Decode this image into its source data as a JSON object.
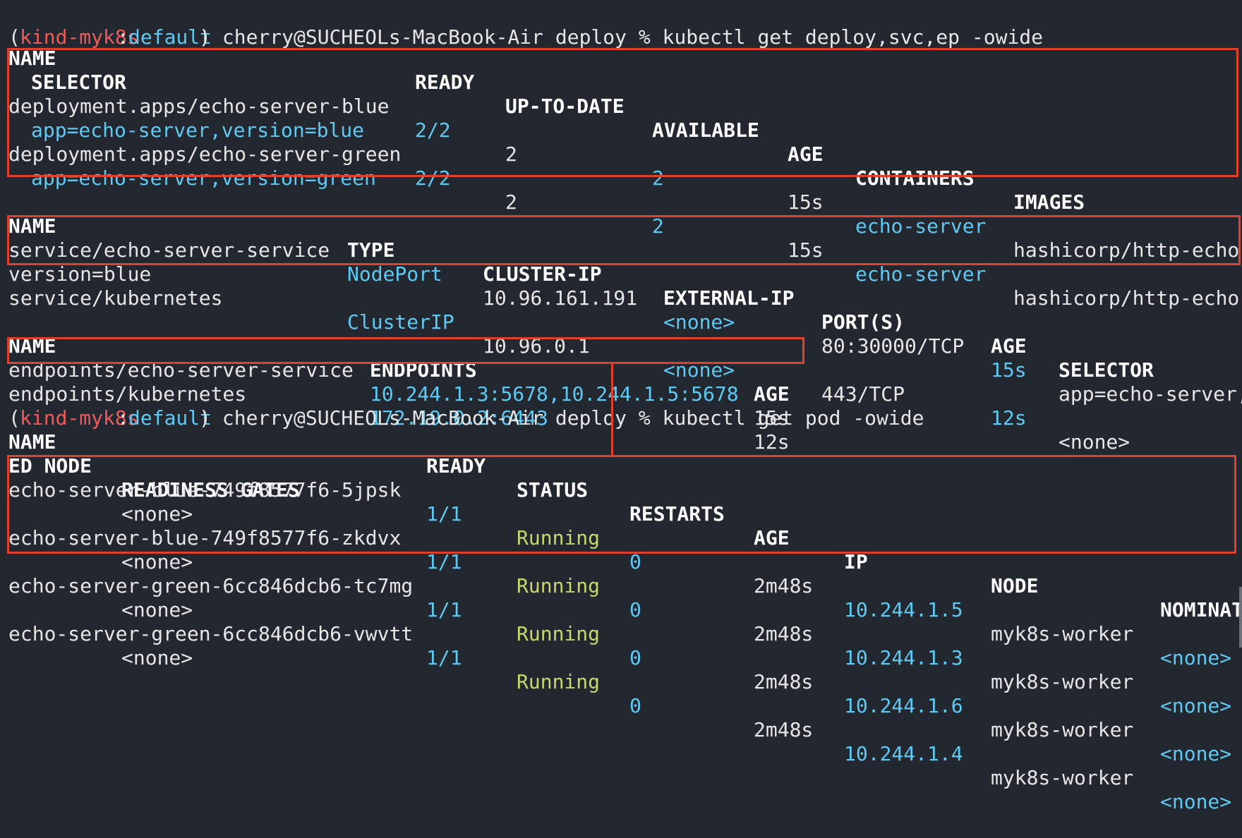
{
  "accent_colors": {
    "background": "#232830",
    "text": "#e6e6e6",
    "header": "#ffffff",
    "cyan": "#5ec9f2",
    "green": "#c5d96a",
    "prompt_red": "#f05a5a",
    "annotation_box": "#e0402c"
  },
  "prompt1": {
    "open": "(",
    "context": "kind-myk8s",
    "colon": ":",
    "namespace": "default",
    "close": ")",
    "text": " cherry@SUCHEOLs-MacBook-Air deploy % kubectl get deploy,svc,ep -owide"
  },
  "deploy": {
    "headers": {
      "name": "NAME",
      "ready": "READY",
      "uptodate": "UP-TO-DATE",
      "available": "AVAILABLE",
      "age": "AGE",
      "containers": "CONTAINERS",
      "images": "IMAGES",
      "selector": "SELECTOR"
    },
    "rows": [
      {
        "name": "deployment.apps/echo-server-blue",
        "ready": "2/2",
        "uptodate": "2",
        "available": "2",
        "age": "15s",
        "containers": "echo-server",
        "images": "hashicorp/http-echo",
        "selector": "app=echo-server,version=blue"
      },
      {
        "name": "deployment.apps/echo-server-green",
        "ready": "2/2",
        "uptodate": "2",
        "available": "2",
        "age": "15s",
        "containers": "echo-server",
        "images": "hashicorp/http-echo",
        "selector": "app=echo-server,version=green"
      }
    ]
  },
  "svc": {
    "headers": {
      "name": "NAME",
      "type": "TYPE",
      "clusterip": "CLUSTER-IP",
      "externalip": "EXTERNAL-IP",
      "ports": "PORT(S)",
      "age": "AGE",
      "selector": "SELECTOR"
    },
    "rows": [
      {
        "name": "service/echo-server-service",
        "type": "NodePort",
        "clusterip": "10.96.161.191",
        "externalip": "<none>",
        "ports": "80:30000/TCP",
        "age": "15s",
        "selector": "app=echo-server,",
        "selector_cont": "version=blue"
      },
      {
        "name": "service/kubernetes",
        "type": "ClusterIP",
        "clusterip": "10.96.0.1",
        "externalip": "<none>",
        "ports": "443/TCP",
        "age": "12s",
        "selector": "<none>"
      }
    ]
  },
  "ep": {
    "headers": {
      "name": "NAME",
      "endpoints": "ENDPOINTS",
      "age": "AGE"
    },
    "rows": [
      {
        "name": "endpoints/echo-server-service",
        "endpoints": "10.244.1.3:5678,10.244.1.5:5678",
        "age": "15s"
      },
      {
        "name": "endpoints/kubernetes",
        "endpoints": "172.19.0.2:6443",
        "age": "12s"
      }
    ]
  },
  "prompt2": {
    "open": "(",
    "context": "kind-myk8s",
    "colon": ":",
    "namespace": "default",
    "close": ")",
    "text": " cherry@SUCHEOLs-MacBook-Air deploy % kubectl get pod -owide"
  },
  "pod": {
    "headers": {
      "name": "NAME",
      "ready": "READY",
      "status": "STATUS",
      "restarts": "RESTARTS",
      "age": "AGE",
      "ip": "IP",
      "node": "NODE",
      "nominated_a": "NOMINAT",
      "nominated_b": "ED NODE",
      "gates": "READINESS GATES"
    },
    "rows": [
      {
        "name": "echo-server-blue-749f8577f6-5jpsk",
        "ready": "1/1",
        "status": "Running",
        "restarts": "0",
        "age": "2m48s",
        "ip": "10.244.1.5",
        "node": "myk8s-worker",
        "nominated": "<none>",
        "gates": "<none>"
      },
      {
        "name": "echo-server-blue-749f8577f6-zkdvx",
        "ready": "1/1",
        "status": "Running",
        "restarts": "0",
        "age": "2m48s",
        "ip": "10.244.1.3",
        "node": "myk8s-worker",
        "nominated": "<none>",
        "gates": "<none>"
      },
      {
        "name": "echo-server-green-6cc846dcb6-tc7mg",
        "ready": "1/1",
        "status": "Running",
        "restarts": "0",
        "age": "2m48s",
        "ip": "10.244.1.6",
        "node": "myk8s-worker",
        "nominated": "<none>",
        "gates": "<none>"
      },
      {
        "name": "echo-server-green-6cc846dcb6-vwvtt",
        "ready": "1/1",
        "status": "Running",
        "restarts": "0",
        "age": "2m48s",
        "ip": "10.244.1.4",
        "node": "myk8s-worker",
        "nominated": "<none>",
        "gates": "<none>"
      }
    ]
  }
}
